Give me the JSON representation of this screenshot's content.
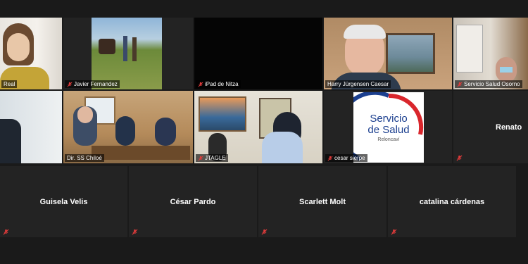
{
  "participants": [
    {
      "name": "Real",
      "muted": false
    },
    {
      "name": "Javier Fernandez",
      "muted": true
    },
    {
      "name": "iPad de Nitza",
      "muted": true
    },
    {
      "name": "Harry Jürgensen Caesar",
      "muted": false
    },
    {
      "name": "Servicio Salud Osorno",
      "muted": true
    },
    {
      "name": "Dir. SS Chiloé",
      "muted": false
    },
    {
      "name": "JTAGLE",
      "muted": true
    },
    {
      "name": "cesar sierpe",
      "muted": true
    },
    {
      "name": "Renato",
      "muted": true
    },
    {
      "name": "Guisela Velis",
      "muted": true
    },
    {
      "name": "César Pardo",
      "muted": true
    },
    {
      "name": "Scarlett Molt",
      "muted": true
    },
    {
      "name": "catalina cárdenas",
      "muted": true
    }
  ],
  "logo": {
    "line1": "Servicio",
    "line2": "de Salud",
    "line3": "Reloncaví"
  },
  "colors": {
    "speaking_border": "#d6d24a",
    "mute_red": "#e03b3b",
    "logo_blue": "#1b3f8f",
    "logo_red": "#d9262c"
  }
}
